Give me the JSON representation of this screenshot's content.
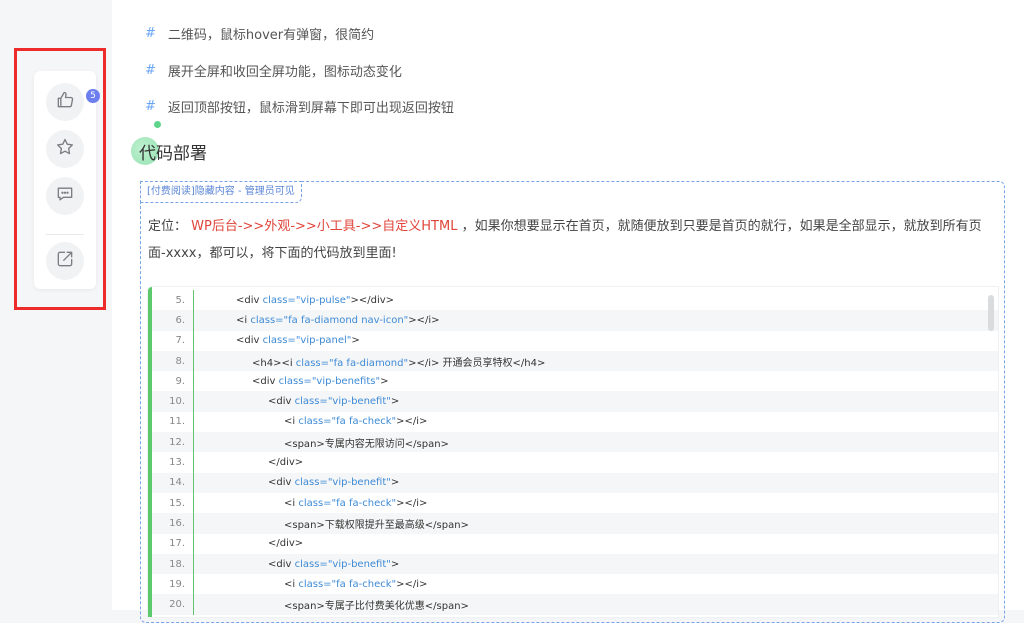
{
  "features": [
    "二维码，鼠标hover有弹窗，很简约",
    "展开全屏和收回全屏功能，图标动态变化",
    "返回顶部按钮，鼠标滑到屏幕下即可出现返回按钮"
  ],
  "bullet_mark": "#",
  "section_title": "代码部署",
  "hidden_content_label": "[付费阅读]隐藏内容 - 管理员可见",
  "deploy_paragraph": {
    "prefix": "定位：",
    "path": "WP后台->>外观->>小工具->>自定义HTML",
    "rest": "，如果你想要显示在首页，就随便放到只要是首页的就行，如果是全部显示，就放到所有页面-xxxx，都可以，将下面的代码放到里面!"
  },
  "code_lines": [
    {
      "no": "5.",
      "indent": 0,
      "pre": "<div ",
      "attr": "class=",
      "val": "\"vip-pulse\"",
      "post": "></div>"
    },
    {
      "no": "6.",
      "indent": 0,
      "pre": "<i ",
      "attr": "class=",
      "val": "\"fa fa-diamond nav-icon\"",
      "post": "></i>"
    },
    {
      "no": "7.",
      "indent": 0,
      "pre": "<div ",
      "attr": "class=",
      "val": "\"vip-panel\"",
      "post": ">"
    },
    {
      "no": "8.",
      "indent": 1,
      "pre": "<h4><i ",
      "attr": "class=",
      "val": "\"fa fa-diamond\"",
      "post": "></i> 开通会员享特权</h4>"
    },
    {
      "no": "9.",
      "indent": 1,
      "pre": "<div ",
      "attr": "class=",
      "val": "\"vip-benefits\"",
      "post": ">"
    },
    {
      "no": "10.",
      "indent": 2,
      "pre": "<div ",
      "attr": "class=",
      "val": "\"vip-benefit\"",
      "post": ">"
    },
    {
      "no": "11.",
      "indent": 3,
      "pre": "<i ",
      "attr": "class=",
      "val": "\"fa fa-check\"",
      "post": "></i>"
    },
    {
      "no": "12.",
      "indent": 3,
      "pre": "<span>专属内容无限访问</span>",
      "attr": "",
      "val": "",
      "post": ""
    },
    {
      "no": "13.",
      "indent": 2,
      "pre": "</div>",
      "attr": "",
      "val": "",
      "post": ""
    },
    {
      "no": "14.",
      "indent": 2,
      "pre": "<div ",
      "attr": "class=",
      "val": "\"vip-benefit\"",
      "post": ">"
    },
    {
      "no": "15.",
      "indent": 3,
      "pre": "<i ",
      "attr": "class=",
      "val": "\"fa fa-check\"",
      "post": "></i>"
    },
    {
      "no": "16.",
      "indent": 3,
      "pre": "<span>下载权限提升至最高级</span>",
      "attr": "",
      "val": "",
      "post": ""
    },
    {
      "no": "17.",
      "indent": 2,
      "pre": "</div>",
      "attr": "",
      "val": "",
      "post": ""
    },
    {
      "no": "18.",
      "indent": 2,
      "pre": "<div ",
      "attr": "class=",
      "val": "\"vip-benefit\"",
      "post": ">"
    },
    {
      "no": "19.",
      "indent": 3,
      "pre": "<i ",
      "attr": "class=",
      "val": "\"fa fa-check\"",
      "post": "></i>"
    },
    {
      "no": "20.",
      "indent": 3,
      "pre": "<span>专属子比付费美化优惠</span>",
      "attr": "",
      "val": "",
      "post": ""
    }
  ],
  "side_actions": {
    "like_count": "5",
    "icons": [
      "thumbs-up-icon",
      "star-icon",
      "comment-icon",
      "share-icon"
    ]
  },
  "colors": {
    "accent_blue": "#6aa6f8",
    "code_border_green": "#5cc96c",
    "highlight_red": "#ee2b2b",
    "path_red": "#e0443a",
    "badge": "#6c7ef0"
  }
}
